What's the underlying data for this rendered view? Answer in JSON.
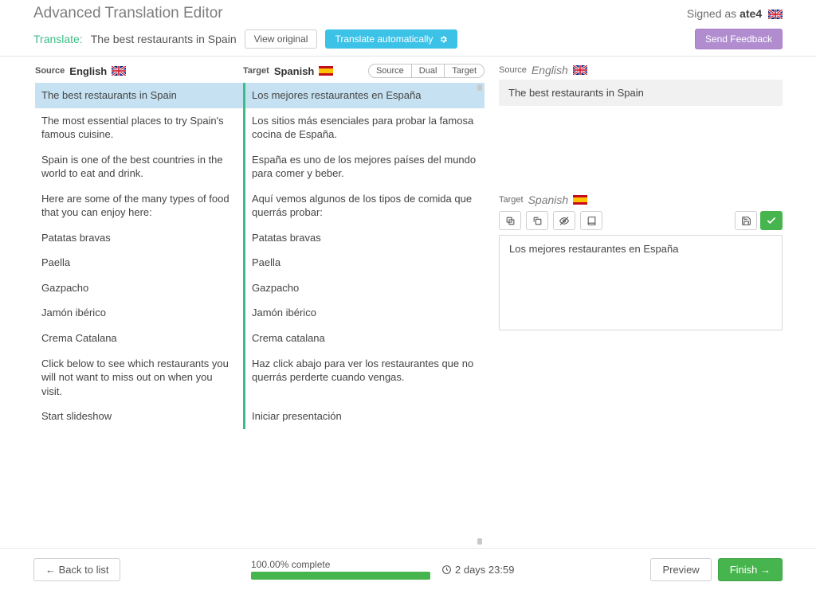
{
  "header": {
    "app_title": "Advanced Translation Editor",
    "signed_as_prefix": "Signed as ",
    "signed_as_user": "ate4"
  },
  "subnav": {
    "translate_label": "Translate:",
    "document_title": "The best restaurants in Spain",
    "view_original": "View original",
    "translate_auto": "Translate automatically",
    "send_feedback": "Send Feedback"
  },
  "langs": {
    "source_label": "Source",
    "source_lang": "English",
    "target_label": "Target",
    "target_lang": "Spanish"
  },
  "view_toggle": {
    "source": "Source",
    "dual": "Dual",
    "target": "Target"
  },
  "segments": [
    {
      "src": "The best restaurants in Spain",
      "tgt": "Los mejores restaurantes en España",
      "selected": true
    },
    {
      "src": "The most essential places to try Spain's famous cuisine.",
      "tgt": "Los sitios más esenciales para probar la famosa cocina de España."
    },
    {
      "src": "Spain is one of the best countries in the world to eat and drink.",
      "tgt": "España es uno de los mejores países del mundo para comer y beber."
    },
    {
      "src": "Here are some of the many types of food that you can enjoy here:",
      "tgt": "Aquí vemos algunos de los tipos de comida que querrás probar:"
    },
    {
      "src": "Patatas bravas",
      "tgt": "Patatas bravas"
    },
    {
      "src": "Paella",
      "tgt": "Paella"
    },
    {
      "src": "Gazpacho",
      "tgt": "Gazpacho"
    },
    {
      "src": "Jamón ibérico",
      "tgt": "Jamón ibérico"
    },
    {
      "src": "Crema Catalana",
      "tgt": "Crema catalana"
    },
    {
      "src": "Click below to see which restaurants you will not want to miss out on when you visit.",
      "tgt": "Haz click abajo para ver los restaurantes que no querrás perderte cuando vengas."
    },
    {
      "src": "Start slideshow",
      "tgt": "Iniciar presentación"
    }
  ],
  "detail": {
    "source_label": "Source",
    "source_lang": "English",
    "source_text": "The best restaurants in Spain",
    "target_label": "Target",
    "target_lang": "Spanish",
    "target_text": "Los mejores restaurantes en España"
  },
  "footer": {
    "back": "← Back to list",
    "progress_text": "100.00% complete",
    "progress_pct": 100,
    "deadline": "2 days 23:59",
    "preview": "Preview",
    "finish": "Finish →"
  }
}
